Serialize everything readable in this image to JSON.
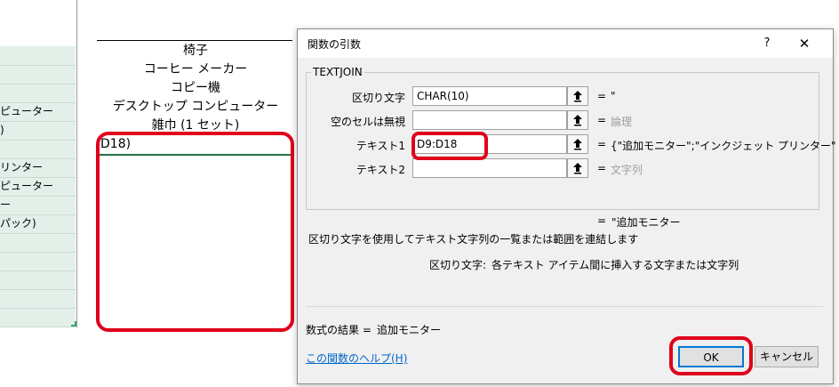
{
  "left_sheet": {
    "rows": [
      "",
      "",
      "",
      "ピューター",
      ")",
      "",
      "リンター",
      "ピューター",
      "ー",
      "パック)",
      "",
      "",
      "",
      "",
      ""
    ]
  },
  "mid_sheet": {
    "items": [
      "椅子",
      "コーヒー メーカー",
      "コピー機",
      "デスクトップ コンピューター",
      "雑巾 (1 セット)"
    ],
    "formula_cell": "D18)"
  },
  "dialog": {
    "title": "関数の引数",
    "help_button": "?",
    "close_button": "✕",
    "function_name": "TEXTJOIN",
    "args": [
      {
        "label": "区切り文字",
        "value": "CHAR(10)",
        "result": "\"",
        "result_gray": false
      },
      {
        "label": "空のセルは無視",
        "value": "",
        "result": "論理",
        "result_gray": true
      },
      {
        "label": "テキスト1",
        "value": "D9:D18",
        "result": "{\"追加モニター\";\"インクジェット プリンター\"",
        "result_gray": false
      },
      {
        "label": "テキスト2",
        "value": "",
        "result": "文字列",
        "result_gray": true
      }
    ],
    "equals_sign": "=",
    "function_result": "\"追加モニター",
    "description": "区切り文字を使用してテキスト文字列の一覧または範囲を連結します",
    "arg_desc_name": "区切り文字:",
    "arg_desc_text": "各テキスト アイテム間に挿入する文字または文字列",
    "formula_result_label": "数式の結果 =",
    "formula_result_value": "追加モニター",
    "help_link": "この関数のヘルプ(H)",
    "ok_label": "OK",
    "cancel_label": "キャンセル"
  },
  "colors": {
    "highlight_red": "#e0001b",
    "sheet_green": "#e3f0ea",
    "link_blue": "#0066cc",
    "ok_border": "#0078d7"
  }
}
